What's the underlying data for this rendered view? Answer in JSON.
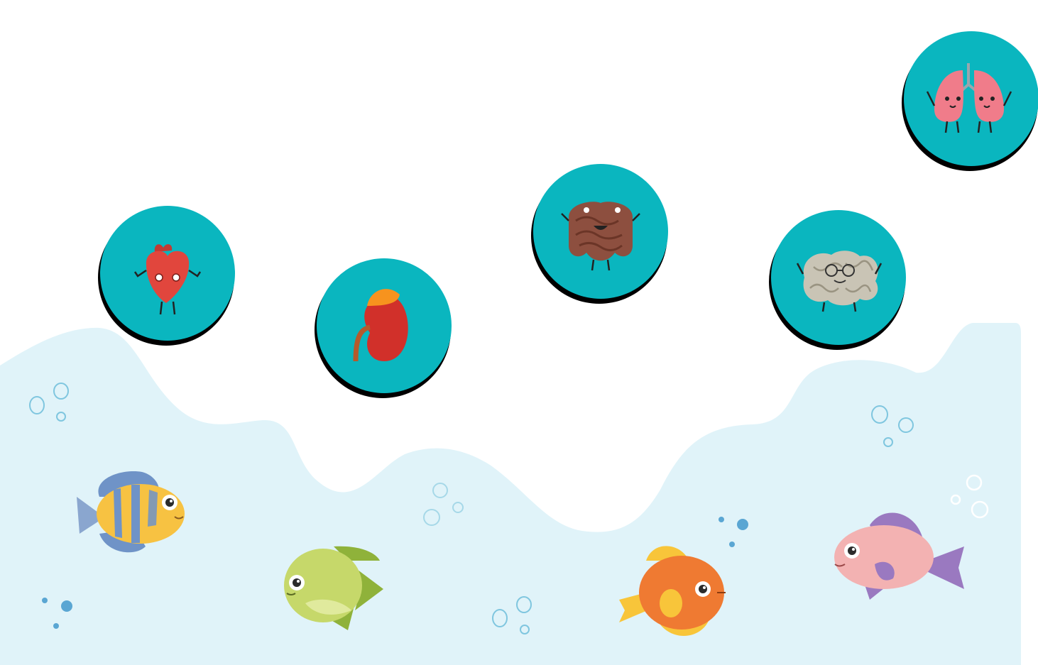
{
  "scene": {
    "background": "#ffffff",
    "water_color": "#e0f3f9",
    "bubble_outline": "#7fc6df",
    "bubble_fill": "#5aa6d3"
  },
  "organs": {
    "circle_color": "#0ab6bf",
    "shadow_color": "#000000",
    "items": [
      {
        "name": "heart",
        "icon": "heart-icon"
      },
      {
        "name": "kidney",
        "icon": "kidney-icon"
      },
      {
        "name": "intestine",
        "icon": "intestine-icon"
      },
      {
        "name": "brain",
        "icon": "brain-icon"
      },
      {
        "name": "lungs",
        "icon": "lungs-icon"
      }
    ]
  },
  "fish": [
    {
      "color": "#f7c242",
      "stripe": "#6f93c7"
    },
    {
      "color": "#c6d86a",
      "stripe": "#8fb23a"
    },
    {
      "color": "#ef7a32",
      "stripe": "#f8c53a"
    },
    {
      "color": "#f3b2b2",
      "stripe": "#9a79c0"
    }
  ]
}
